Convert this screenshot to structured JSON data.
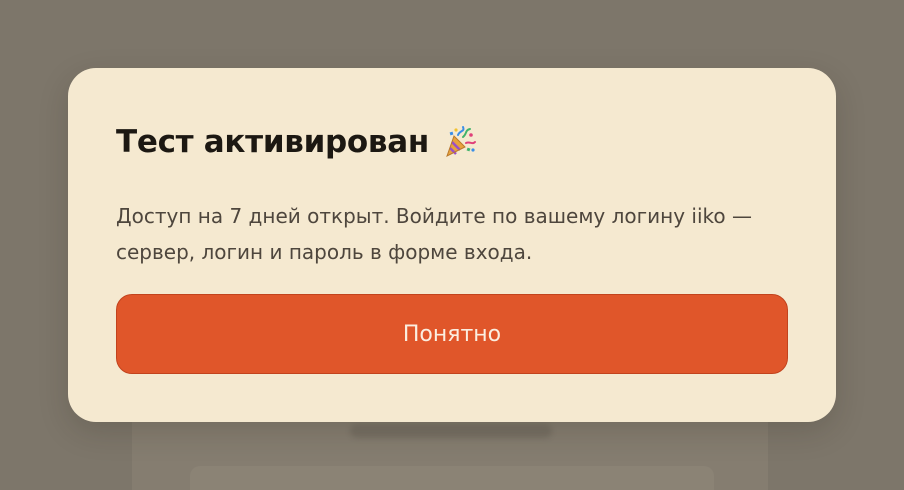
{
  "modal": {
    "title": "Тест активирован",
    "title_icon": "party-popper-icon",
    "body": "Доступ на 7 дней открыт. Войдите по вашему логину iiko — сервер, логин и пароль в форме входа.",
    "button_label": "Понятно"
  },
  "colors": {
    "overlay": "#7d766a",
    "modal_background": "#f5e9d0",
    "accent_button": "#e0562a",
    "title_text": "#1c1812",
    "body_text": "#4e463d"
  }
}
